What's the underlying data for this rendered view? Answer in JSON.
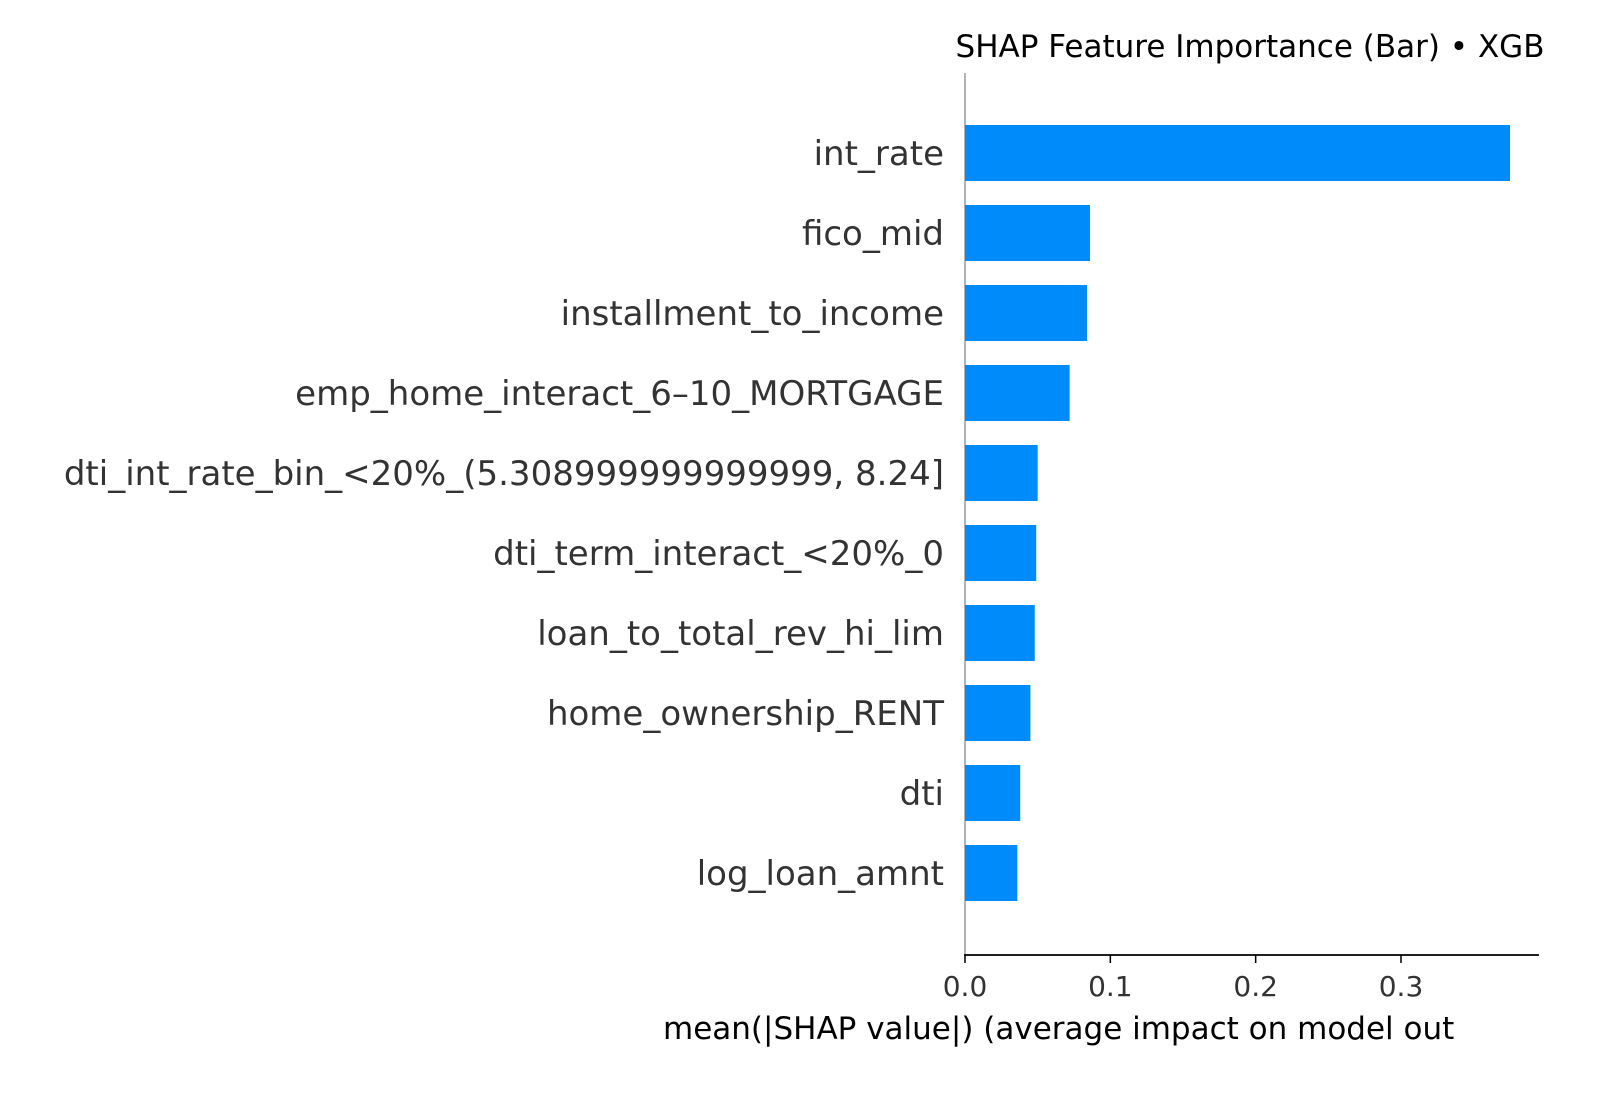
{
  "chart_data": {
    "type": "bar",
    "orientation": "horizontal",
    "title": "SHAP Feature Importance (Bar) • XGB",
    "xlabel": "mean(|SHAP value|) (average impact on model out",
    "ylabel": "",
    "categories": [
      "int_rate",
      "fico_mid",
      "installment_to_income",
      "emp_home_interact_6–10_MORTGAGE",
      "dti_int_rate_bin_<20%_(5.308999999999999, 8.24]",
      "dti_term_interact_<20%_0",
      "loan_to_total_rev_hi_lim",
      "home_ownership_RENT",
      "dti",
      "log_loan_amnt"
    ],
    "values": [
      0.375,
      0.086,
      0.084,
      0.072,
      0.05,
      0.049,
      0.048,
      0.045,
      0.038,
      0.036
    ],
    "xticks": [
      0.0,
      0.1,
      0.2,
      0.3
    ],
    "xtick_labels": [
      "0.0",
      "0.1",
      "0.2",
      "0.3"
    ],
    "xlim": [
      0,
      0.395
    ],
    "grid": false,
    "legend": "none",
    "bar_color": "#008bfb"
  }
}
